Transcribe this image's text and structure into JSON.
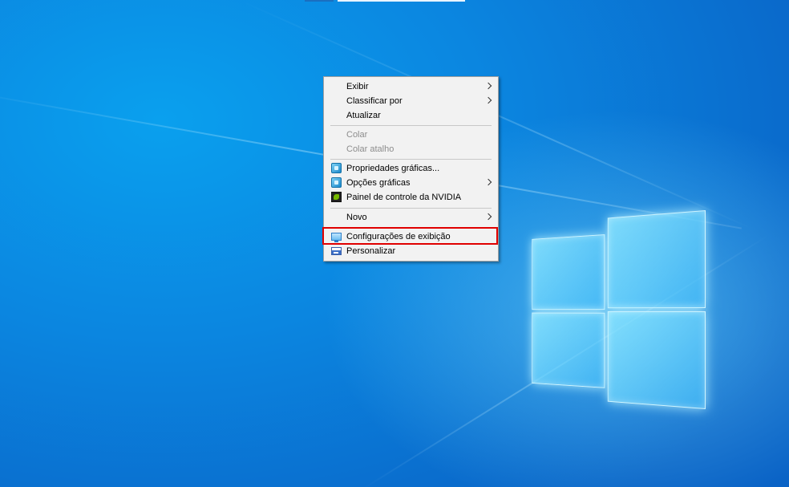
{
  "desktop": {
    "accent_color": "#0b86e0",
    "highlight_color": "#e00000"
  },
  "context_menu": {
    "items": [
      {
        "label": "Exibir",
        "has_submenu": true,
        "enabled": true,
        "icon": null
      },
      {
        "label": "Classificar por",
        "has_submenu": true,
        "enabled": true,
        "icon": null
      },
      {
        "label": "Atualizar",
        "has_submenu": false,
        "enabled": true,
        "icon": null
      },
      {
        "label": "Colar",
        "has_submenu": false,
        "enabled": false,
        "icon": null
      },
      {
        "label": "Colar atalho",
        "has_submenu": false,
        "enabled": false,
        "icon": null
      },
      {
        "label": "Propriedades gráficas...",
        "has_submenu": false,
        "enabled": true,
        "icon": "intel-graphics-icon"
      },
      {
        "label": "Opções gráficas",
        "has_submenu": true,
        "enabled": true,
        "icon": "intel-graphics-icon"
      },
      {
        "label": "Painel de controle da NVIDIA",
        "has_submenu": false,
        "enabled": true,
        "icon": "nvidia-icon"
      },
      {
        "label": "Novo",
        "has_submenu": true,
        "enabled": true,
        "icon": null
      },
      {
        "label": "Configurações de exibição",
        "has_submenu": false,
        "enabled": true,
        "icon": "display-settings-icon",
        "highlighted": true
      },
      {
        "label": "Personalizar",
        "has_submenu": false,
        "enabled": true,
        "icon": "personalize-icon"
      }
    ]
  }
}
